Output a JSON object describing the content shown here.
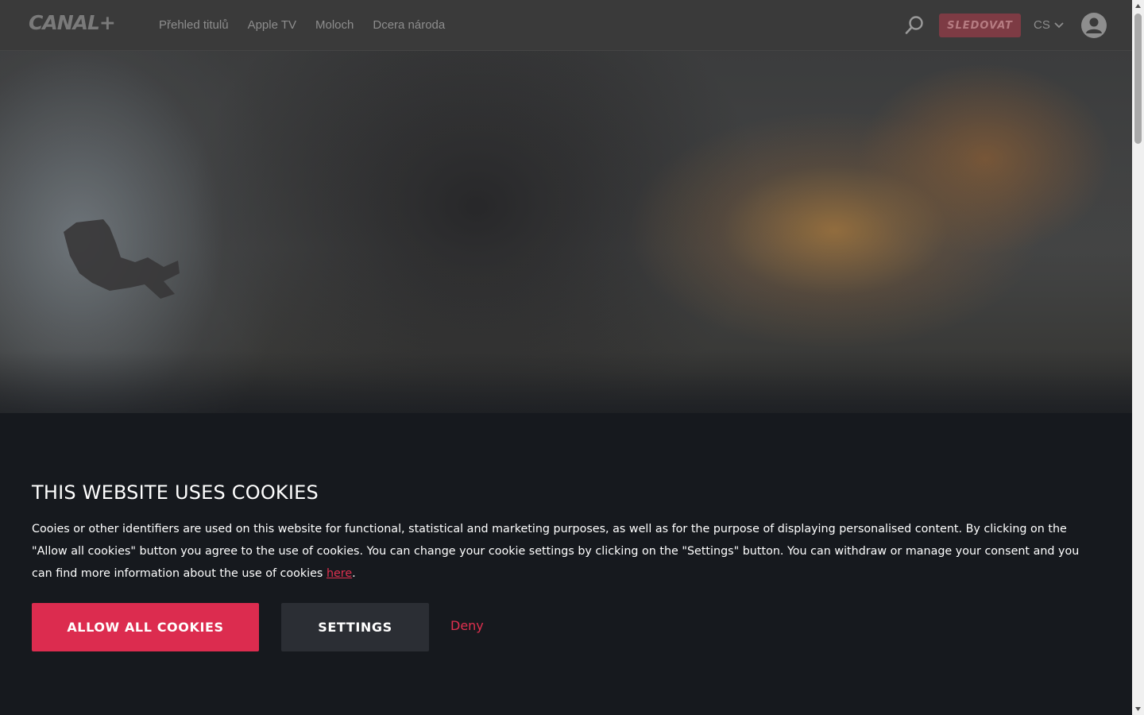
{
  "header": {
    "logo_text": "CANAL+",
    "nav": [
      {
        "label": "Přehled titulů"
      },
      {
        "label": "Apple TV"
      },
      {
        "label": "Moloch"
      },
      {
        "label": "Dcera národa"
      }
    ],
    "watch_label": "SLEDOVAT",
    "language": "CS"
  },
  "cookie": {
    "title": "THIS WEBSITE USES COOKIES",
    "text_before_link": "Cooies or other identifiers are used on this website for functional, statistical and marketing purposes, as well as for the purpose of displaying personalised content. By clicking on the \"Allow all cookies\" button you agree to the use of cookies. You can change your cookie settings by clicking on the \"Settings\" button. You can withdraw or manage your consent and you can find more information about the use of cookies ",
    "link_label": "here",
    "text_after_link": ".",
    "allow_label": "ALLOW ALL COOKIES",
    "settings_label": "SETTINGS",
    "deny_label": "Deny"
  },
  "colors": {
    "accent": "#dc2c4f",
    "banner_bg": "#16191e",
    "header_bg": "#3a3a3a"
  },
  "icons": {
    "search": "search-icon",
    "language_chevron": "chevron-down-icon",
    "account": "user-icon"
  }
}
